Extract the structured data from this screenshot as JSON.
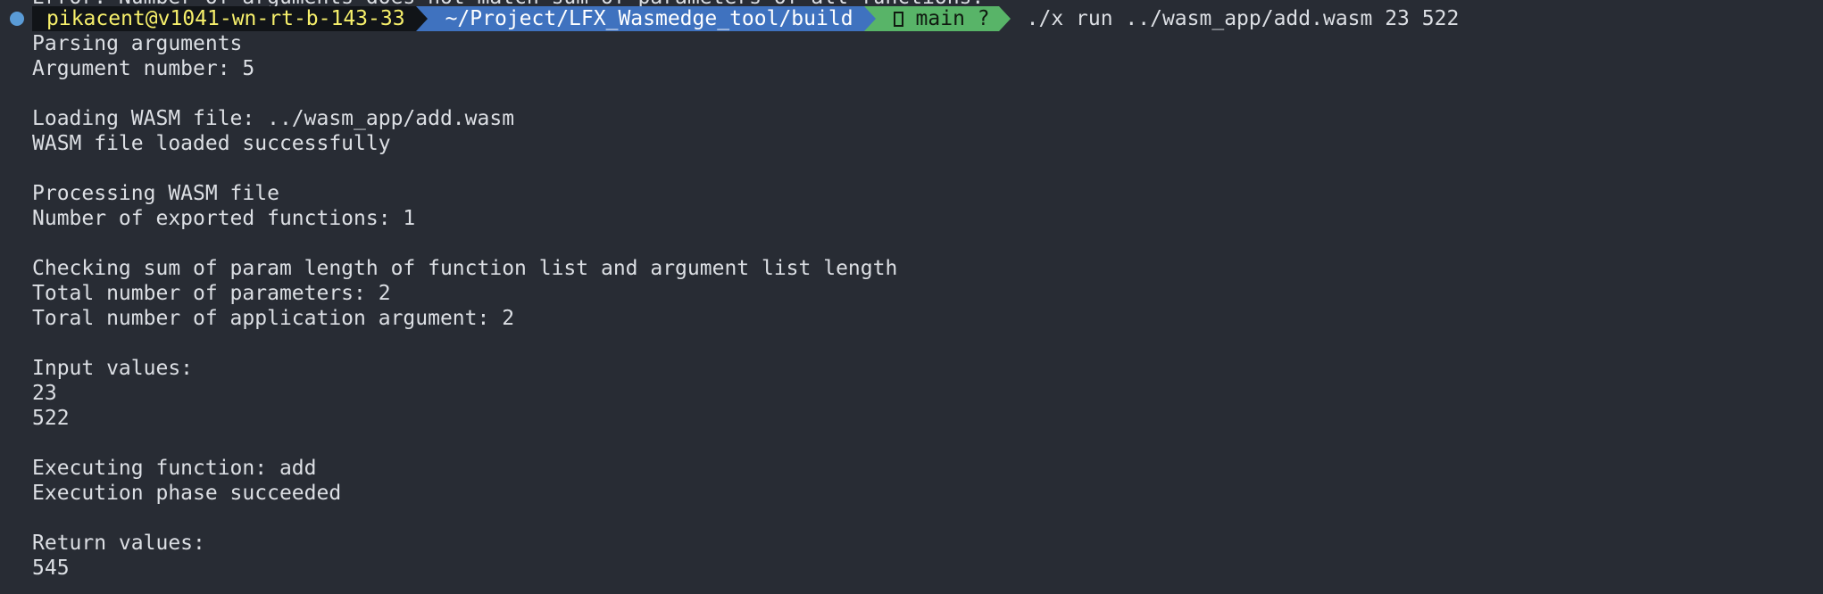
{
  "terminal": {
    "previous_line": "Error: Number of arguments does not match sum of parameters of all functions.",
    "prompt": {
      "user_host": "pikacent@v1041-wn-rt-b-143-33",
      "path": "~/Project/LFX_Wasmedge_tool/build",
      "git_branch": "main ?",
      "branch_icon": "git-branch-icon",
      "command": "./x run ../wasm_app/add.wasm 23 522"
    },
    "output_lines": [
      "Parsing arguments",
      "Argument number: 5",
      "",
      "Loading WASM file: ../wasm_app/add.wasm",
      "WASM file loaded successfully",
      "",
      "Processing WASM file",
      "Number of exported functions: 1",
      "",
      "Checking sum of param length of function list and argument list length",
      "Total number of parameters: 2",
      "Toral number of application argument: 2",
      "",
      "Input values:",
      "23",
      "522",
      "",
      "Executing function: add",
      "Execution phase succeeded",
      "",
      "Return values:",
      "545"
    ],
    "colors": {
      "background": "#282c34",
      "text": "#dcdfe4",
      "user_segment_bg": "#111418",
      "user_segment_fg": "#f6ef6b",
      "path_segment_bg": "#3f72bf",
      "git_segment_bg": "#58b468",
      "status_dot": "#5a9bd6"
    }
  }
}
